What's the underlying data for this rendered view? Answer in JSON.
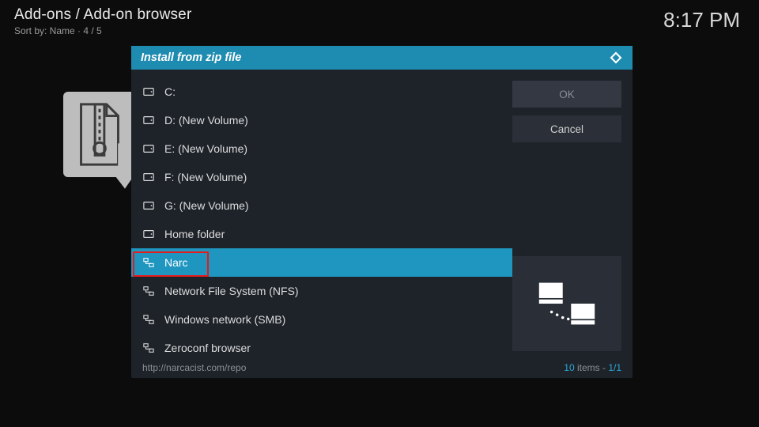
{
  "header": {
    "breadcrumb": "Add-ons / Add-on browser",
    "sort_line": "Sort by: Name  ·  4 / 5",
    "clock": "8:17 PM"
  },
  "dialog": {
    "title": "Install from zip file",
    "buttons": {
      "ok": "OK",
      "cancel": "Cancel"
    },
    "list": [
      {
        "label": "C:",
        "icon": "disk"
      },
      {
        "label": "D: (New Volume)",
        "icon": "disk"
      },
      {
        "label": "E: (New Volume)",
        "icon": "disk"
      },
      {
        "label": "F: (New Volume)",
        "icon": "disk"
      },
      {
        "label": "G: (New Volume)",
        "icon": "disk"
      },
      {
        "label": "Home folder",
        "icon": "disk"
      },
      {
        "label": "Narc",
        "icon": "net",
        "selected": true
      },
      {
        "label": "Network File System (NFS)",
        "icon": "net"
      },
      {
        "label": "Windows network (SMB)",
        "icon": "net"
      },
      {
        "label": "Zeroconf browser",
        "icon": "net"
      }
    ],
    "footer": {
      "path": "http://narcacist.com/repo",
      "count_num": "10",
      "count_after": " items - ",
      "count_page": "1/1"
    }
  }
}
